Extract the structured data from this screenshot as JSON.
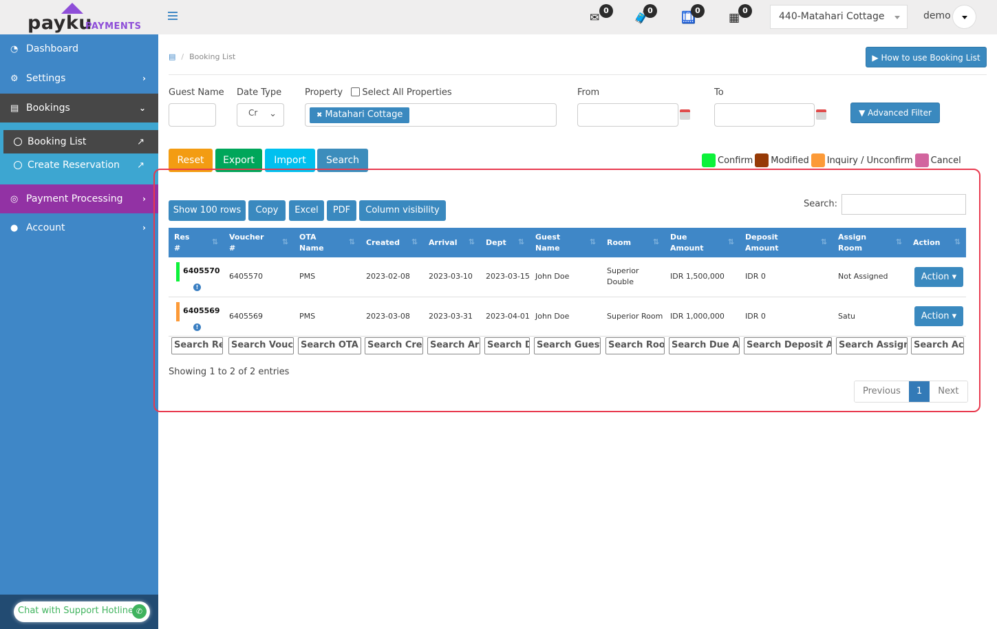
{
  "brand": {
    "name": "payku",
    "sub": "PAYMENTS"
  },
  "header": {
    "notifications": [
      {
        "icon": "envelope-open-icon",
        "count": "0"
      },
      {
        "icon": "checkin-traveller-icon",
        "count": "0"
      },
      {
        "icon": "checkout-traveller-icon",
        "count": "0"
      },
      {
        "icon": "calendar-icon",
        "count": "0"
      }
    ],
    "property_select": "440-Matahari Cottage",
    "user": "demo"
  },
  "sidebar": {
    "items": [
      {
        "label": "Dashboard",
        "icon": "dashboard-icon"
      },
      {
        "label": "Settings",
        "icon": "gear-icon"
      },
      {
        "label": "Bookings",
        "icon": "bookings-icon"
      },
      {
        "label": "Payment Processing",
        "icon": "target-icon"
      },
      {
        "label": "Account",
        "icon": "user-icon"
      }
    ],
    "sub_items": [
      {
        "label": "Booking List"
      },
      {
        "label": "Create Reservation"
      }
    ],
    "chat": "Chat with Support Hotline"
  },
  "breadcrumb": {
    "current": "Booking List"
  },
  "howto_label": "How to use Booking List",
  "filters": {
    "guest_name_label": "Guest Name",
    "guest_name_value": "",
    "date_type_label": "Date Type",
    "date_type_value": "Cr",
    "property_label": "Property",
    "select_all_label": "Select All Properties",
    "property_chip": "Matahari Cottage",
    "from_label": "From",
    "from_value": "",
    "to_label": "To",
    "to_value": "",
    "advanced_label": "Advanced Filter"
  },
  "actions": {
    "reset": "Reset",
    "export": "Export",
    "import": "Import",
    "search": "Search"
  },
  "legend": [
    {
      "label": "Confirm",
      "color": "#0df23a"
    },
    {
      "label": "Modified",
      "color": "#963a06"
    },
    {
      "label": "Inquiry / Unconfirm",
      "color": "#fc9a38"
    },
    {
      "label": "Cancel",
      "color": "#d2659e"
    }
  ],
  "dt_buttons": {
    "show_rows": "Show 100 rows",
    "copy": "Copy",
    "excel": "Excel",
    "pdf": "PDF",
    "colvis": "Column visibility"
  },
  "search_label": "Search:",
  "search_value": "",
  "table": {
    "headers": [
      [
        "Res",
        "#"
      ],
      [
        "Voucher",
        "#"
      ],
      [
        "OTA",
        "Name"
      ],
      [
        "Created"
      ],
      [
        "Arrival"
      ],
      [
        "Dept"
      ],
      [
        "Guest",
        "Name"
      ],
      [
        "Room"
      ],
      [
        "Due",
        "Amount"
      ],
      [
        "Deposit",
        "Amount"
      ],
      [
        "Assign",
        "Room"
      ],
      [
        "Action"
      ]
    ],
    "rows": [
      {
        "status_color": "#0df23a",
        "res": "6405570",
        "voucher": "6405570",
        "ota": "PMS",
        "created": "2023-02-08",
        "arrival": "2023-03-10",
        "dept": "2023-03-15",
        "guest": "John Doe",
        "room": "Superior Double",
        "due": "IDR 1,500,000",
        "deposit": "IDR 0",
        "assign": "Not Assigned",
        "action": "Action"
      },
      {
        "status_color": "#fc9a38",
        "res": "6405569",
        "voucher": "6405569",
        "ota": "PMS",
        "created": "2023-03-08",
        "arrival": "2023-03-31",
        "dept": "2023-04-01",
        "guest": "John Doe",
        "room": "Superior Room",
        "due": "IDR 1,000,000",
        "deposit": "IDR 0",
        "assign": "Satu",
        "action": "Action"
      }
    ],
    "footer_search": [
      "Search  Re",
      "Search Vouch",
      "Search OTA N",
      "Search Crea",
      "Search Arr",
      "Search D",
      "Search Guest",
      "Search Roo",
      "Search Due An",
      "Search Deposit An",
      "Search Assign",
      "Search Act"
    ]
  },
  "info": "Showing 1 to 2 of 2 entries",
  "pagination": {
    "previous": "Previous",
    "current": "1",
    "next": "Next"
  }
}
